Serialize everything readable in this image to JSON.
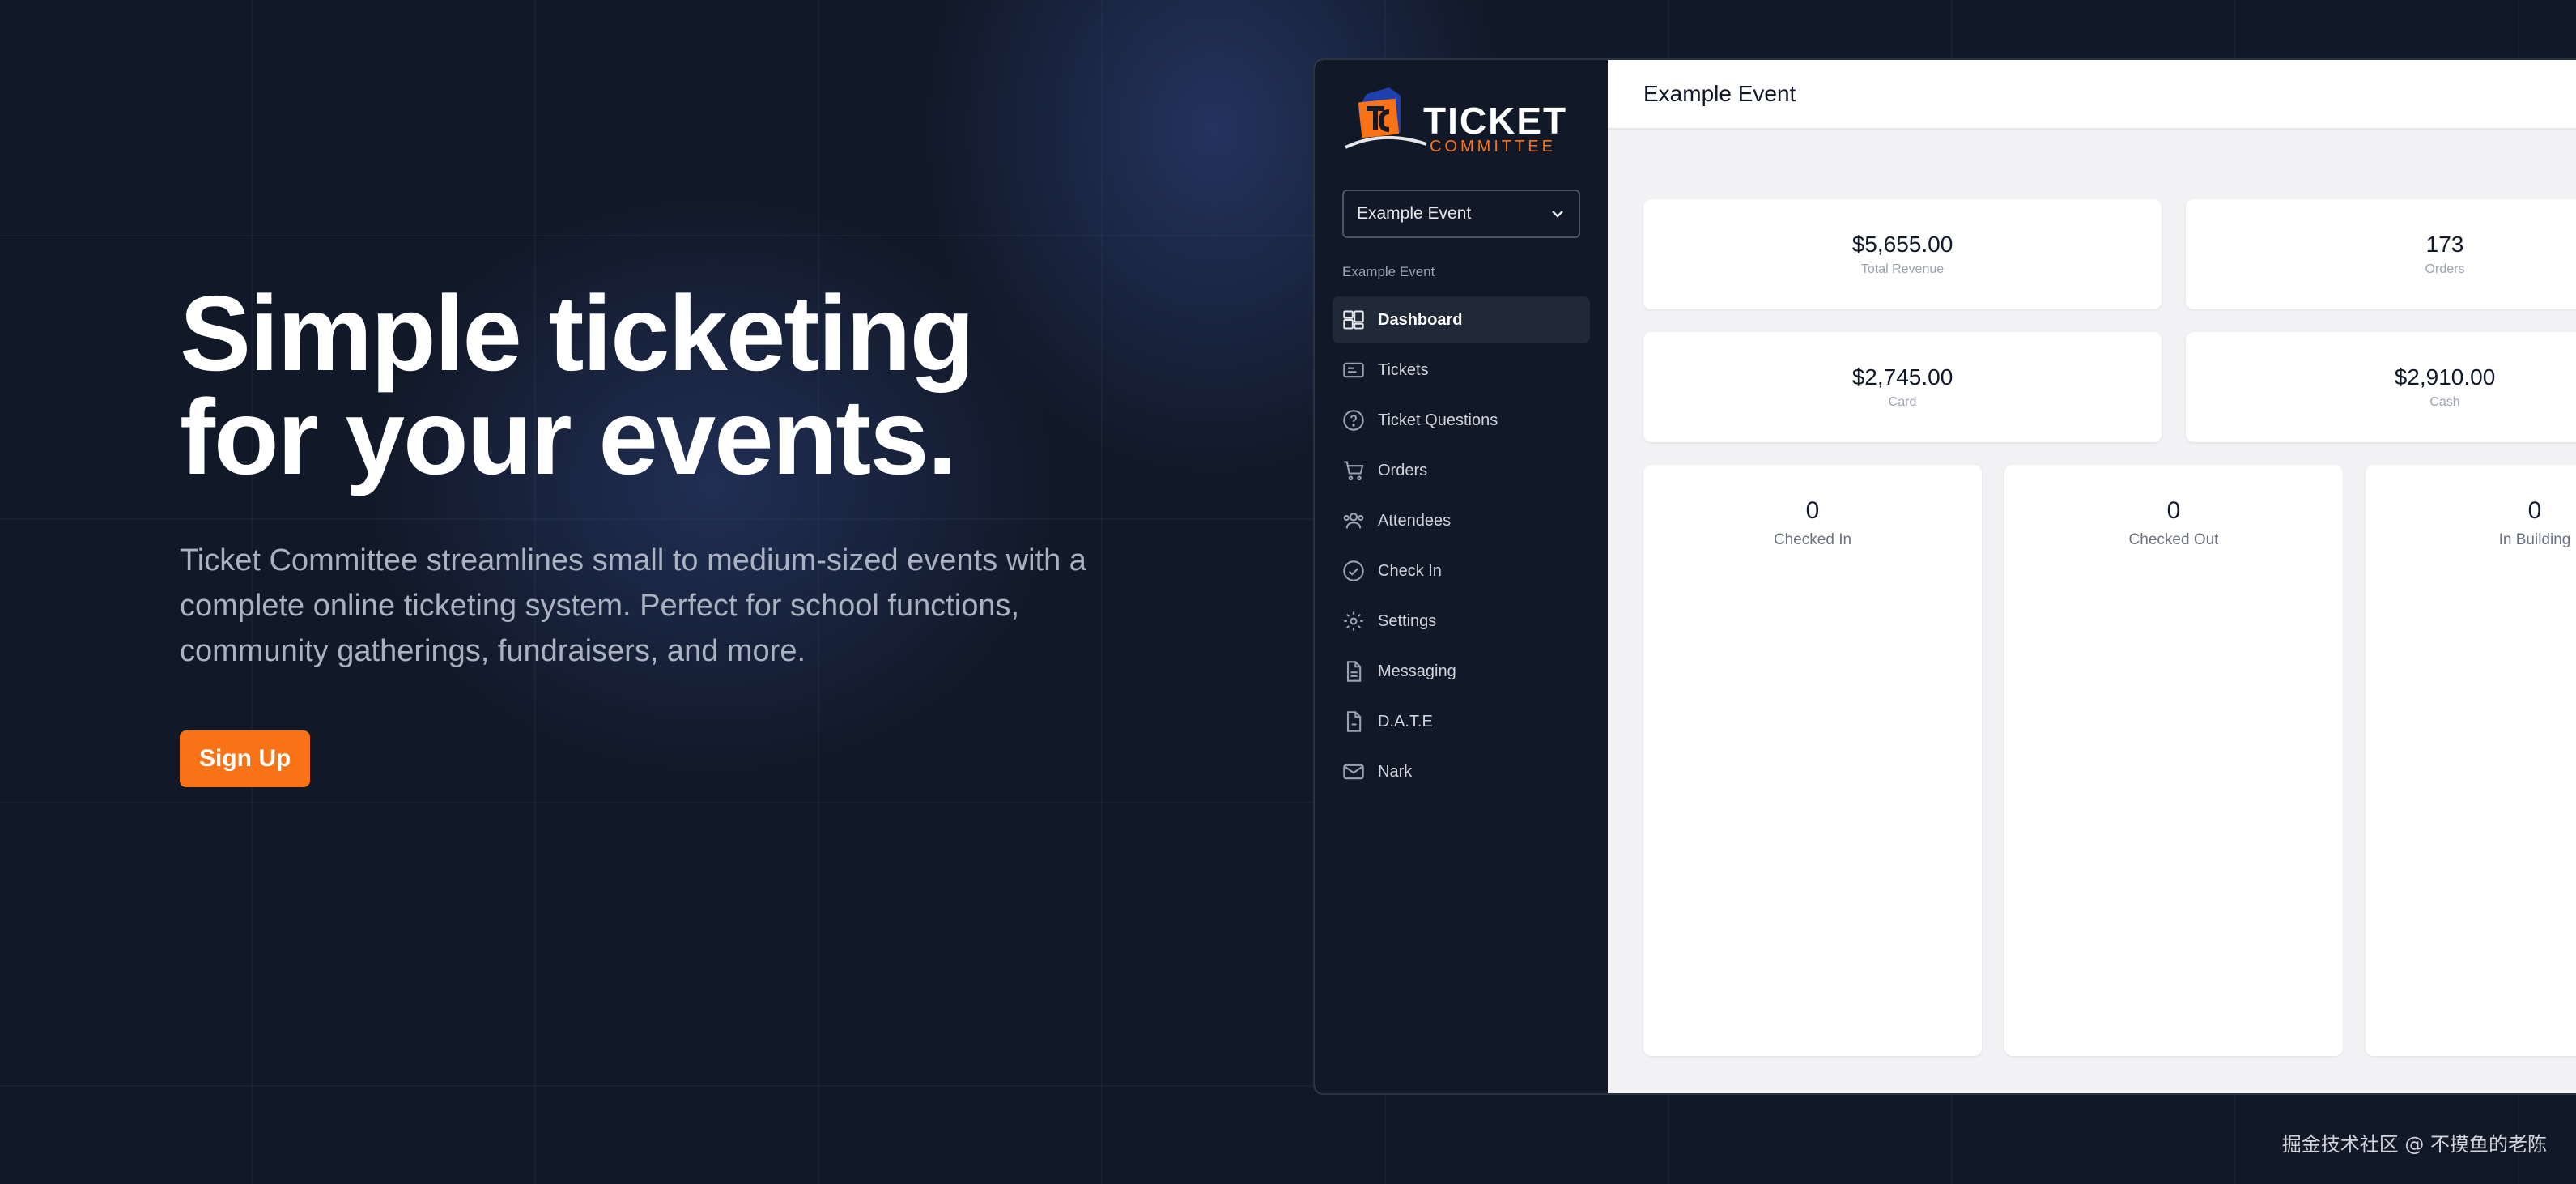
{
  "hero": {
    "title_line1": "Simple ticketing",
    "title_line2": "for your events.",
    "subtitle": "Ticket Committee streamlines small to medium-sized events with a complete online ticketing system. Perfect for school functions, community gatherings, fundraisers, and more.",
    "signup_label": "Sign Up"
  },
  "sidebar": {
    "logo_line1": "TICKET",
    "logo_line2": "COMMITTEE",
    "event_select": "Example Event",
    "section_label": "Example Event",
    "items": [
      {
        "label": "Dashboard",
        "icon": "dashboard-icon",
        "active": true
      },
      {
        "label": "Tickets",
        "icon": "ticket-icon"
      },
      {
        "label": "Ticket Questions",
        "icon": "question-icon"
      },
      {
        "label": "Orders",
        "icon": "cart-icon"
      },
      {
        "label": "Attendees",
        "icon": "users-icon"
      },
      {
        "label": "Check In",
        "icon": "check-circle-icon"
      },
      {
        "label": "Settings",
        "icon": "gear-icon"
      },
      {
        "label": "Messaging",
        "icon": "document-icon"
      },
      {
        "label": "D.A.T.E",
        "icon": "file-icon"
      },
      {
        "label": "Nark",
        "icon": "mail-icon"
      }
    ]
  },
  "main": {
    "title": "Example Event",
    "stats": [
      {
        "value": "$5,655.00",
        "label": "Total Revenue"
      },
      {
        "value": "173",
        "label": "Orders"
      },
      {
        "value": "$2,745.00",
        "label": "Card"
      },
      {
        "value": "$2,910.00",
        "label": "Cash"
      }
    ],
    "checkins": [
      {
        "value": "0",
        "label": "Checked In"
      },
      {
        "value": "0",
        "label": "Checked Out"
      },
      {
        "value": "0",
        "label": "In Building"
      }
    ]
  },
  "watermark": "掘金技术社区 @ 不摸鱼的老陈",
  "colors": {
    "accent": "#f97316",
    "background": "#111827",
    "sidebar": "#111827",
    "content": "#f2f2f5"
  }
}
